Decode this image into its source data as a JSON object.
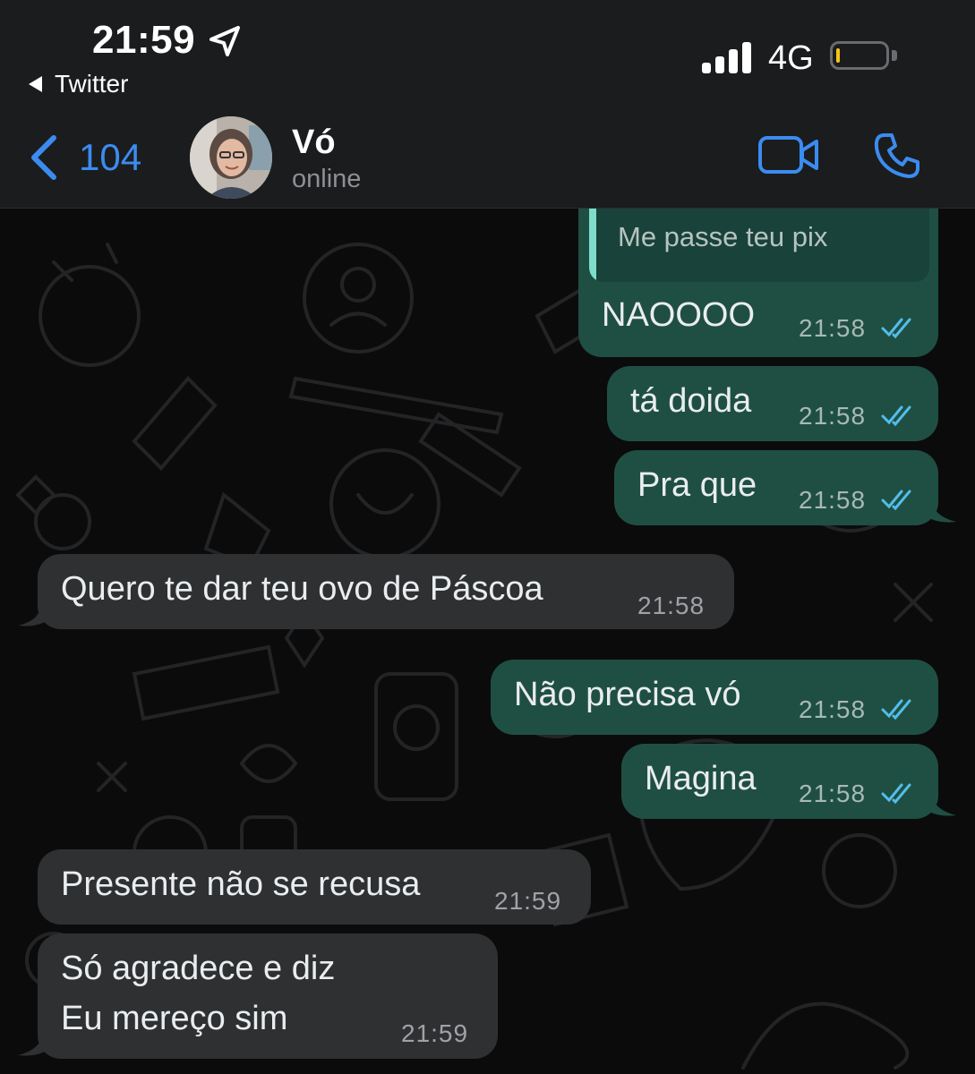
{
  "status_bar": {
    "time": "21:59",
    "back_app": "Twitter",
    "network": "4G",
    "battery_level": 0.05
  },
  "header": {
    "unread_count": "104",
    "contact_name": "Vó",
    "contact_status": "online"
  },
  "colors": {
    "accent": "#3b8cf0",
    "outgoing_bubble": "#1f4f43",
    "incoming_bubble": "#2f3032",
    "read_ticks": "#53bdeb"
  },
  "messages": [
    {
      "dir": "out",
      "quoted": "Me passe teu pix",
      "text": "NAOOOO",
      "time": "21:58",
      "read": true
    },
    {
      "dir": "out",
      "text": "tá doida",
      "time": "21:58",
      "read": true
    },
    {
      "dir": "out",
      "text": "Pra que",
      "time": "21:58",
      "read": true
    },
    {
      "dir": "in",
      "text": "Quero te dar teu ovo de Páscoa",
      "time": "21:58"
    },
    {
      "dir": "out",
      "text": "Não precisa vó",
      "time": "21:58",
      "read": true
    },
    {
      "dir": "out",
      "text": "Magina",
      "time": "21:58",
      "read": true
    },
    {
      "dir": "in",
      "text": "Presente não se recusa",
      "time": "21:59"
    },
    {
      "dir": "in",
      "lines": [
        "Só agradece e diz",
        "Eu mereço sim"
      ],
      "time": "21:59"
    }
  ]
}
